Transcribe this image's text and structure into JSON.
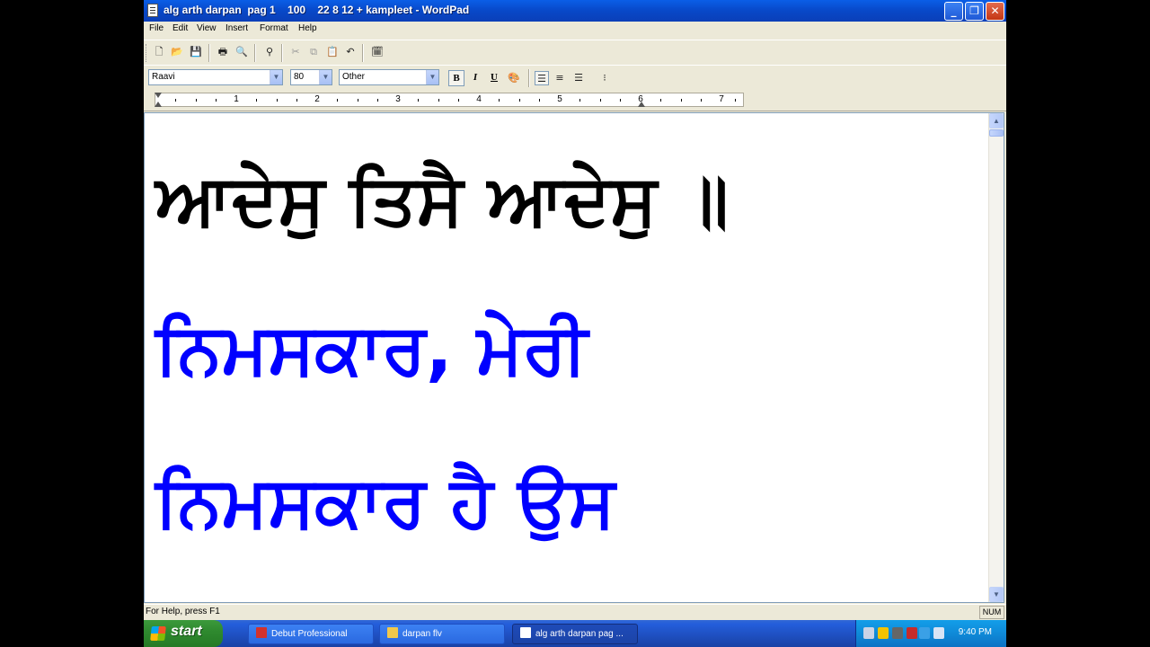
{
  "window": {
    "title": "alg arth darpan  pag 1    100    22 8 12 + kampleet - WordPad",
    "minimize": "_",
    "maximize": "❐",
    "close": "✕"
  },
  "menu": [
    "File",
    "Edit",
    "View",
    "Insert",
    "Format",
    "Help"
  ],
  "format_bar": {
    "font_name": "Raavi",
    "font_size": "80",
    "script": "Other",
    "bold": "B",
    "italic": "I",
    "underline": "U"
  },
  "ruler": {
    "numbers": [
      "1",
      "2",
      "3",
      "4",
      "5",
      "6",
      "7"
    ]
  },
  "document": {
    "lines": [
      {
        "text": "ਆਦੇਸੁ ਤਿਸੈ ਆਦੇਸੁ ॥",
        "color": "#000000"
      },
      {
        "text": "ਨਿਮਸਕਾਰ, ਮੇਰੀ",
        "color": "#0000ff"
      },
      {
        "text": "ਨਿਮਸਕਾਰ ਹੈ ਉਸ",
        "color": "#0000ff"
      }
    ]
  },
  "statusbar": {
    "help": "For Help, press F1",
    "num": "NUM"
  },
  "taskbar": {
    "start": "start",
    "tasks": [
      {
        "label": "Debut Professional",
        "icon_color": "#d2322d"
      },
      {
        "label": "darpan flv",
        "icon_color": "#f2c84b"
      },
      {
        "label": "alg arth darpan  pag ...",
        "icon_color": "#ffffff"
      }
    ],
    "clock": "9:40 PM"
  }
}
